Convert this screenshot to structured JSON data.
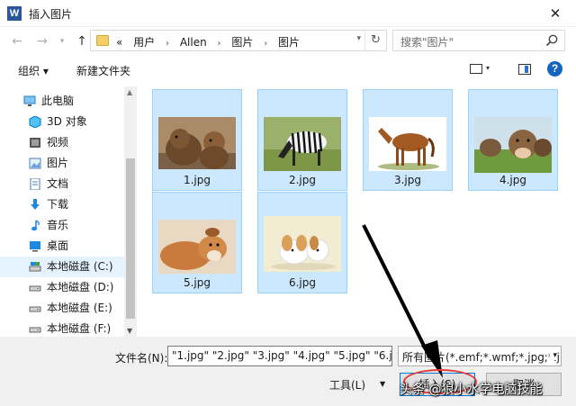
{
  "window": {
    "title": "插入图片",
    "app_icon": "W"
  },
  "nav": {
    "breadcrumb": [
      "«",
      "用户",
      "Allen",
      "图片",
      "图片"
    ],
    "search_placeholder": "搜索\"图片\""
  },
  "toolbar": {
    "organize_label": "组织 ▾",
    "new_folder_label": "新建文件夹",
    "help_label": "?"
  },
  "sidebar": {
    "items": [
      {
        "label": "此电脑",
        "icon": "computer-icon"
      },
      {
        "label": "3D 对象",
        "icon": "cube-icon"
      },
      {
        "label": "视频",
        "icon": "video-icon"
      },
      {
        "label": "图片",
        "icon": "pictures-icon"
      },
      {
        "label": "文档",
        "icon": "documents-icon"
      },
      {
        "label": "下载",
        "icon": "download-icon"
      },
      {
        "label": "音乐",
        "icon": "music-icon"
      },
      {
        "label": "桌面",
        "icon": "desktop-icon"
      },
      {
        "label": "本地磁盘 (C:)",
        "icon": "drive-icon",
        "selected": true
      },
      {
        "label": "本地磁盘 (D:)",
        "icon": "drive-icon"
      },
      {
        "label": "本地磁盘 (E:)",
        "icon": "drive-icon"
      },
      {
        "label": "本地磁盘 (F:)",
        "icon": "drive-icon"
      }
    ]
  },
  "files": [
    {
      "name": "1.jpg",
      "subject": "bears"
    },
    {
      "name": "2.jpg",
      "subject": "zebra"
    },
    {
      "name": "3.jpg",
      "subject": "horse"
    },
    {
      "name": "4.jpg",
      "subject": "cows"
    },
    {
      "name": "5.jpg",
      "subject": "dog"
    },
    {
      "name": "6.jpg",
      "subject": "puppies"
    }
  ],
  "bottom": {
    "filename_label": "文件名(N):",
    "filename_value": "\"1.jpg\" \"2.jpg\" \"3.jpg\" \"4.jpg\" \"5.jpg\" \"6.j",
    "filetype_value": "所有图片(*.emf;*.wmf;*.jpg;*.jp",
    "tools_label": "工具(L)",
    "insert_label": "插入(S)",
    "cancel_label": "取消"
  },
  "watermark": "头条 @狼小水学电脑技能",
  "colors": {
    "selection_bg": "#cce8ff",
    "selection_border": "#99d1ff",
    "accent": "#0078d7",
    "annotation": "#e53935"
  }
}
